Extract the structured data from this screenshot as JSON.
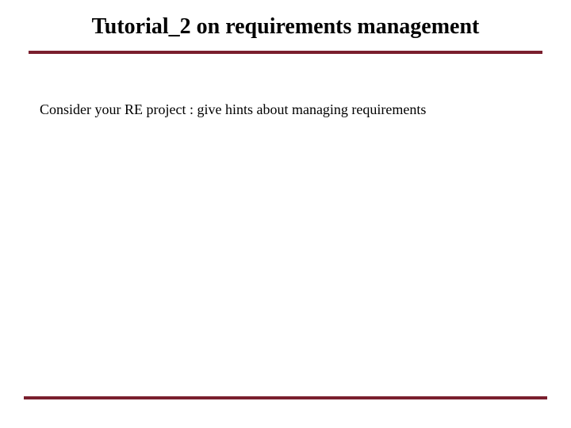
{
  "slide": {
    "title": "Tutorial_2 on requirements management",
    "body": "Consider your RE project : give hints about managing requirements"
  },
  "colors": {
    "accent": "#7a1f2e"
  }
}
